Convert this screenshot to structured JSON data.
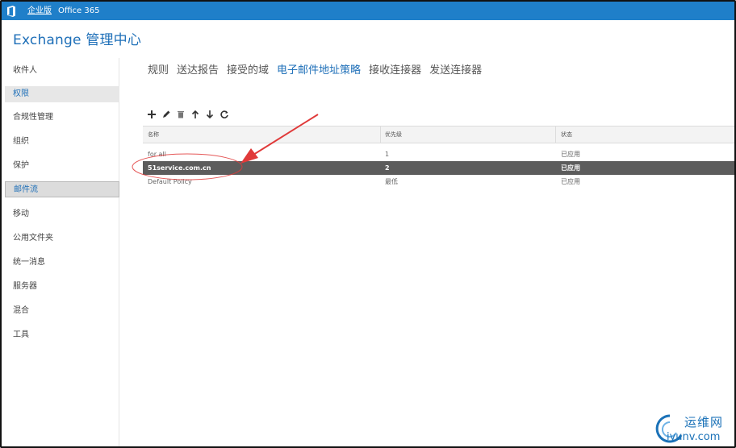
{
  "topbar": {
    "logo_icon": "office-logo-icon",
    "links": [
      "企业版",
      "Office 365"
    ]
  },
  "app": {
    "title": "Exchange 管理中心"
  },
  "sidebar": {
    "items": [
      {
        "label": "收件人"
      },
      {
        "label": "权限"
      },
      {
        "label": "合规性管理"
      },
      {
        "label": "组织"
      },
      {
        "label": "保护"
      },
      {
        "label": "邮件流"
      },
      {
        "label": "移动"
      },
      {
        "label": "公用文件夹"
      },
      {
        "label": "统一消息"
      },
      {
        "label": "服务器"
      },
      {
        "label": "混合"
      },
      {
        "label": "工具"
      }
    ],
    "selected_index": 1,
    "current_index": 5
  },
  "tabs": {
    "items": [
      "规则",
      "送达报告",
      "接受的域",
      "电子邮件地址策略",
      "接收连接器",
      "发送连接器"
    ],
    "active_index": 3
  },
  "toolbar": {
    "icons": [
      "add-icon",
      "edit-icon",
      "delete-icon",
      "move-up-icon",
      "move-down-icon",
      "refresh-icon"
    ]
  },
  "grid": {
    "columns": [
      "名称",
      "优先级",
      "状态"
    ],
    "rows": [
      {
        "name": "for all",
        "priority": "1",
        "status": "已应用"
      },
      {
        "name": "51service.com.cn",
        "priority": "2",
        "status": "已应用"
      },
      {
        "name": "Default Policy",
        "priority": "最低",
        "status": "已应用"
      }
    ],
    "selected_row": 1
  },
  "annotation": {
    "color": "#e03a3a"
  },
  "watermark": {
    "line1": "运维网",
    "line2": "iyunv.com"
  },
  "colors": {
    "topbar": "#1f7fc9",
    "accent": "#1e6fb8",
    "selected_row": "#5c5c5c"
  }
}
